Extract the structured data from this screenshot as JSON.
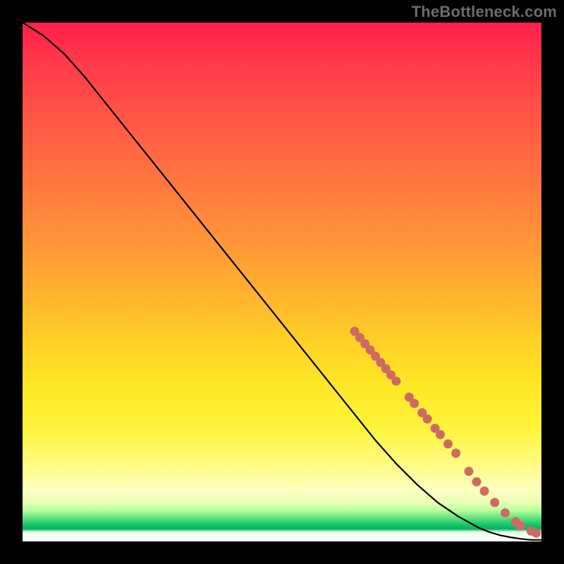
{
  "watermark": "TheBottleneck.com",
  "chart_data": {
    "type": "line",
    "title": "",
    "xlabel": "",
    "ylabel": "",
    "xlim": [
      0,
      100
    ],
    "ylim": [
      0,
      100
    ],
    "grid": false,
    "series": [
      {
        "name": "bottleneck-curve",
        "x": [
          0,
          4,
          8,
          12,
          16,
          20,
          24,
          28,
          32,
          36,
          40,
          44,
          48,
          52,
          56,
          60,
          64,
          68,
          72,
          76,
          80,
          84,
          88,
          90,
          92,
          94,
          96,
          98,
          100
        ],
        "y": [
          100,
          97.5,
          94,
          89.5,
          84.5,
          79.5,
          74.5,
          69.5,
          64.5,
          59.5,
          54.5,
          49.5,
          44.5,
          39.5,
          34.5,
          29.5,
          24.5,
          19.5,
          15,
          11,
          7.5,
          4.8,
          2.6,
          1.8,
          1.2,
          0.8,
          0.5,
          0.3,
          0.3
        ]
      }
    ],
    "markers": [
      {
        "name": "highlighted-segment",
        "color": "#cf6a63",
        "points": [
          {
            "x": 64.0,
            "y": 40.5
          },
          {
            "x": 65.0,
            "y": 39.3
          },
          {
            "x": 66.0,
            "y": 38.1
          },
          {
            "x": 67.0,
            "y": 36.9
          },
          {
            "x": 68.0,
            "y": 35.7
          },
          {
            "x": 69.0,
            "y": 34.5
          },
          {
            "x": 70.0,
            "y": 33.3
          },
          {
            "x": 71.0,
            "y": 32.1
          },
          {
            "x": 72.0,
            "y": 30.9
          },
          {
            "x": 74.5,
            "y": 27.8
          },
          {
            "x": 75.5,
            "y": 26.6
          },
          {
            "x": 77.0,
            "y": 24.8
          },
          {
            "x": 78.0,
            "y": 23.6
          },
          {
            "x": 79.5,
            "y": 21.8
          },
          {
            "x": 80.5,
            "y": 20.6
          },
          {
            "x": 82.0,
            "y": 18.8
          },
          {
            "x": 83.5,
            "y": 17.0
          },
          {
            "x": 86.0,
            "y": 13.5
          },
          {
            "x": 87.5,
            "y": 11.5
          },
          {
            "x": 89.0,
            "y": 9.7
          },
          {
            "x": 91.0,
            "y": 7.5
          },
          {
            "x": 93.0,
            "y": 5.5
          },
          {
            "x": 95.0,
            "y": 3.8
          },
          {
            "x": 96.0,
            "y": 3.0
          },
          {
            "x": 98.0,
            "y": 2.0
          },
          {
            "x": 99.0,
            "y": 1.6
          }
        ]
      }
    ],
    "gradient_stops": [
      {
        "pos": 0,
        "color": "#ff1f4a"
      },
      {
        "pos": 50,
        "color": "#ffb82d"
      },
      {
        "pos": 80,
        "color": "#fff43a"
      },
      {
        "pos": 95,
        "color": "#5fe27d"
      },
      {
        "pos": 100,
        "color": "#ffffff"
      }
    ]
  }
}
